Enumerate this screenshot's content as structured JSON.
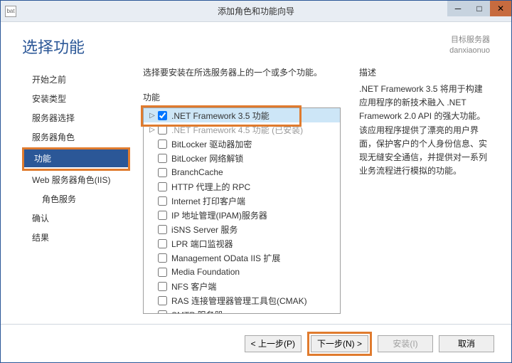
{
  "titlebar": {
    "title": "添加角色和功能向导",
    "icon_text": "bat"
  },
  "header": {
    "page_title": "选择功能",
    "target_label": "目标服务器",
    "target_value": "danxiaonuo"
  },
  "sidebar": {
    "items": [
      {
        "label": "开始之前"
      },
      {
        "label": "安装类型"
      },
      {
        "label": "服务器选择"
      },
      {
        "label": "服务器角色"
      },
      {
        "label": "功能",
        "selected": true
      },
      {
        "label": "Web 服务器角色(IIS)"
      },
      {
        "label": "角色服务",
        "sub": true
      },
      {
        "label": "确认"
      },
      {
        "label": "结果"
      }
    ]
  },
  "main": {
    "intro": "选择要安装在所选服务器上的一个或多个功能。",
    "features_label": "功能",
    "desc_label": "描述",
    "desc_text": ".NET Framework 3.5 将用于构建应用程序的新技术融入 .NET Framework 2.0 API 的强大功能。该应用程序提供了漂亮的用户界面，保护客户的个人身份信息、实现无缝安全通信，并提供对一系列业务流程进行模拟的功能。",
    "features": [
      {
        "label": ".NET Framework 3.5 功能",
        "checked": true,
        "expand": true,
        "selected": true
      },
      {
        "label": ".NET Framework 4.5 功能 (已安装)",
        "checked": false,
        "expand": true,
        "greyed": true
      },
      {
        "label": "BitLocker 驱动器加密"
      },
      {
        "label": "BitLocker 网络解锁"
      },
      {
        "label": "BranchCache"
      },
      {
        "label": "HTTP 代理上的 RPC"
      },
      {
        "label": "Internet 打印客户端"
      },
      {
        "label": "IP 地址管理(IPAM)服务器"
      },
      {
        "label": "iSNS Server 服务"
      },
      {
        "label": "LPR 端口监视器"
      },
      {
        "label": "Management OData IIS 扩展"
      },
      {
        "label": "Media Foundation"
      },
      {
        "label": "NFS 客户端"
      },
      {
        "label": "RAS 连接管理器管理工具包(CMAK)"
      },
      {
        "label": "SMTP 服务器"
      }
    ]
  },
  "footer": {
    "prev": "< 上一步(P)",
    "next": "下一步(N) >",
    "install": "安装(I)",
    "cancel": "取消"
  }
}
